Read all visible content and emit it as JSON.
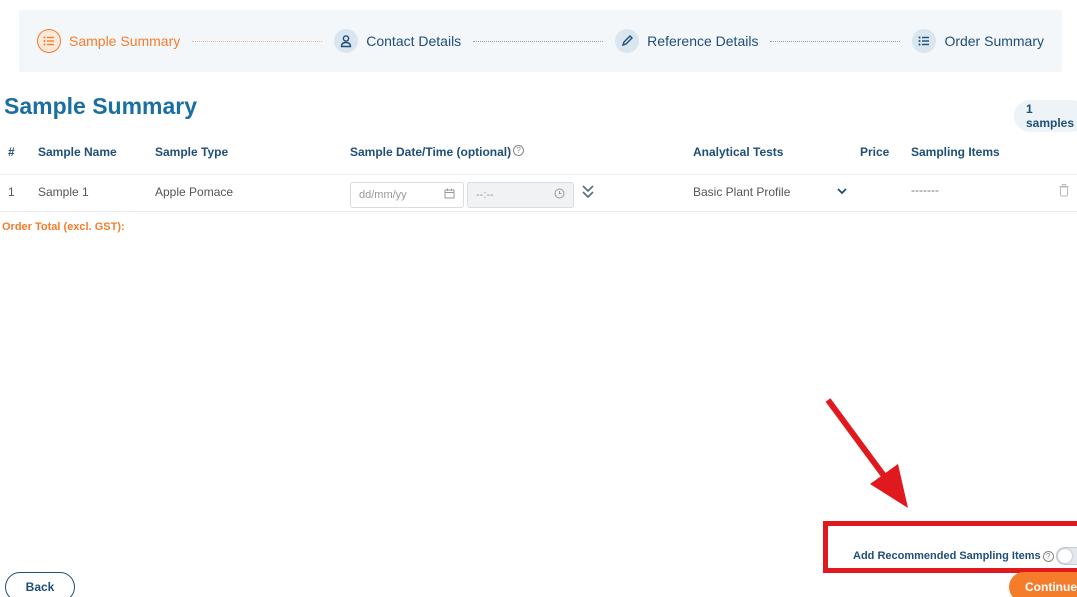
{
  "stepper": {
    "steps": [
      {
        "label": "Sample Summary",
        "icon": "list-icon",
        "state": "active"
      },
      {
        "label": "Contact Details",
        "icon": "person-icon",
        "state": "inactive"
      },
      {
        "label": "Reference Details",
        "icon": "pencil-icon",
        "state": "inactive"
      },
      {
        "label": "Order Summary",
        "icon": "list-icon",
        "state": "inactive"
      }
    ]
  },
  "page": {
    "title": "Sample Summary",
    "sample_count": "1 samples"
  },
  "table": {
    "headers": {
      "index": "#",
      "name": "Sample Name",
      "type": "Sample Type",
      "datetime": "Sample Date/Time (optional)",
      "tests": "Analytical Tests",
      "price": "Price",
      "items": "Sampling Items"
    },
    "rows": [
      {
        "index": "1",
        "name": "Sample 1",
        "type": "Apple Pomace",
        "date_placeholder": "dd/mm/yy",
        "time_placeholder": "--:--",
        "tests": "Basic Plant Profile",
        "price": "",
        "items": "-------"
      }
    ]
  },
  "order_total_label": "Order Total (excl. GST):",
  "recommended": {
    "label": "Add Recommended Sampling Items",
    "enabled": false
  },
  "buttons": {
    "back": "Back",
    "continue": "Continue"
  },
  "colors": {
    "accent": "#f57c2b",
    "primary": "#1f4e79",
    "annotation": "#e0191e"
  }
}
